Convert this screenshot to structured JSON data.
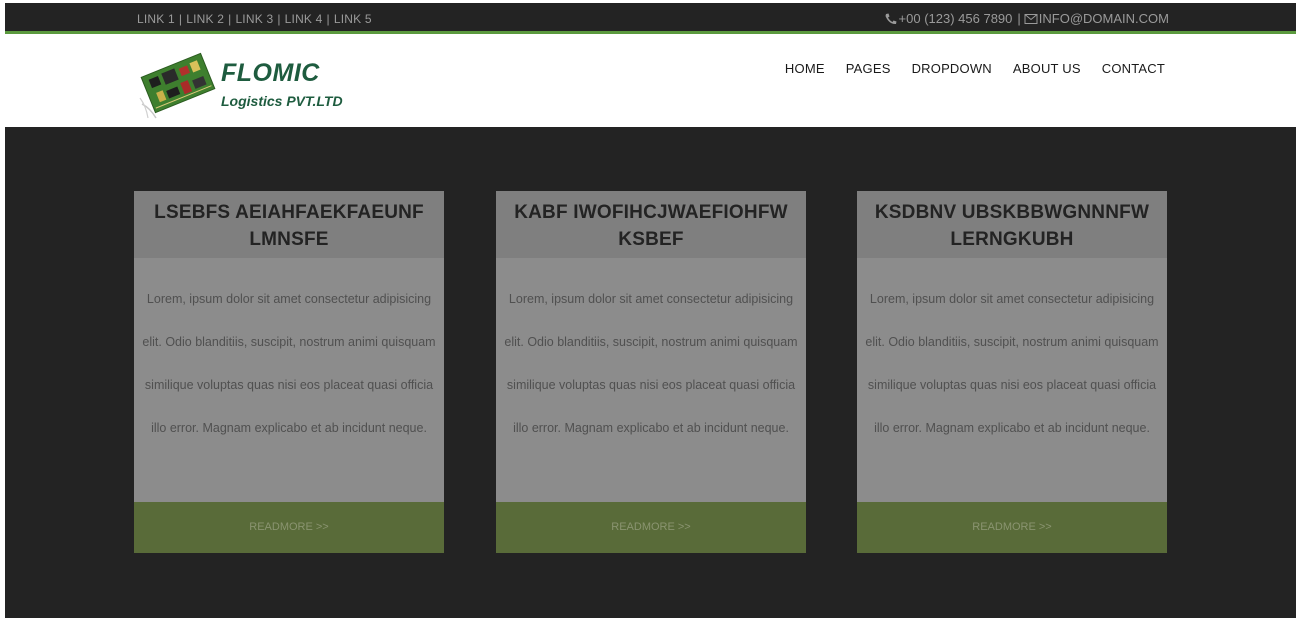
{
  "topbar": {
    "links": [
      "LINK 1",
      "LINK 2",
      "LINK 3",
      "LINK 4",
      "LINK 5"
    ],
    "separator": "|",
    "phone": "+00 (123) 456 7890",
    "email": "INFO@DOMAIN.COM",
    "phone_icon": "phone-icon",
    "email_icon": "envelope-icon"
  },
  "header": {
    "brand": "FLOMIC",
    "subtitle": "Logistics PVT.LTD",
    "logo": "circuit-board-logo",
    "nav": [
      "HOME",
      "PAGES",
      "DROPDOWN",
      "ABOUT US",
      "CONTACT"
    ]
  },
  "cards": [
    {
      "title": "LSEBFS AEIAHFAEKFAEUNF LMNSFE",
      "body": "Lorem, ipsum dolor sit amet consectetur adipisicing elit. Odio blanditiis, suscipit, nostrum animi quisquam similique voluptas quas nisi eos placeat quasi officia illo error. Magnam explicabo et ab incidunt neque.",
      "button": "READMORE >>"
    },
    {
      "title": "KABF IWOFIHCJWAEFIOHFW KSBEF",
      "body": "Lorem, ipsum dolor sit amet consectetur adipisicing elit. Odio blanditiis, suscipit, nostrum animi quisquam similique voluptas quas nisi eos placeat quasi officia illo error. Magnam explicabo et ab incidunt neque.",
      "button": "READMORE >>"
    },
    {
      "title": "KSDBNV UBSKBBWGNNNFW LERNGKUBH",
      "body": "Lorem, ipsum dolor sit amet consectetur adipisicing elit. Odio blanditiis, suscipit, nostrum animi quisquam similique voluptas quas nisi eos placeat quasi officia illo error. Magnam explicabo et ab incidunt neque.",
      "button": "READMORE >>"
    }
  ],
  "colors": {
    "dark": "#232323",
    "accent_green": "#5b9a3e",
    "brand_green": "#1e5c3f",
    "card_button": "#596b39"
  }
}
